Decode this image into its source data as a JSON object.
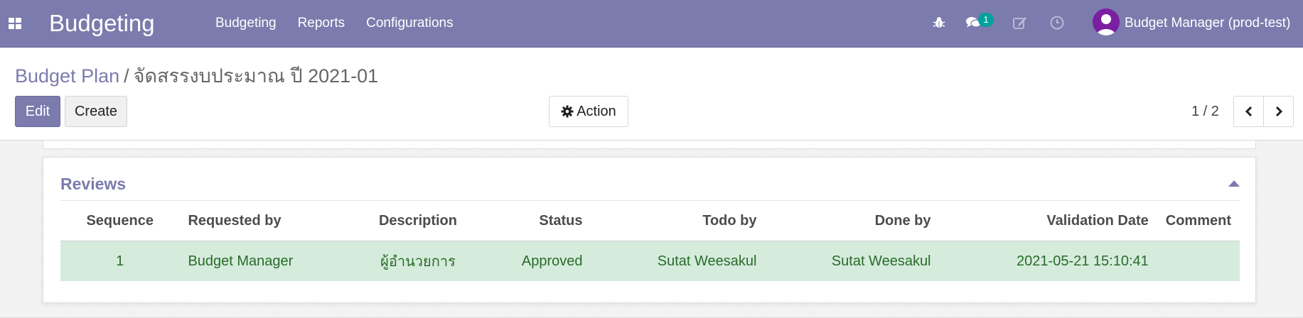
{
  "navbar": {
    "app_name": "Budgeting",
    "menu": [
      "Budgeting",
      "Reports",
      "Configurations"
    ],
    "messages_count": "1",
    "user_name": "Budget Manager (prod-test)",
    "icons": [
      "apps-icon",
      "bug-icon",
      "chat-icon",
      "edit-icon",
      "clock-icon",
      "user-avatar"
    ],
    "color": "#7c7bad"
  },
  "breadcrumb": {
    "parent": "Budget Plan",
    "separator": "/",
    "current": "จัดสรรงบประมาณ ปี 2021-01"
  },
  "buttons": {
    "edit": "Edit",
    "create": "Create",
    "action": "Action"
  },
  "pager": {
    "value": "1 / 2"
  },
  "reviews": {
    "title": "Reviews",
    "columns": [
      "Sequence",
      "Requested by",
      "Description",
      "Status",
      "Todo by",
      "Done by",
      "Validation Date",
      "Comment"
    ],
    "rows": [
      {
        "sequence": "1",
        "requested_by": "Budget Manager",
        "description": "ผู้อำนวยการ",
        "status": "Approved",
        "todo_by": "Sutat Weesakul",
        "done_by": "Sutat Weesakul",
        "validation_date": "2021-05-21 15:10:41",
        "comment": ""
      }
    ],
    "row_color": "#d5ecdc"
  }
}
